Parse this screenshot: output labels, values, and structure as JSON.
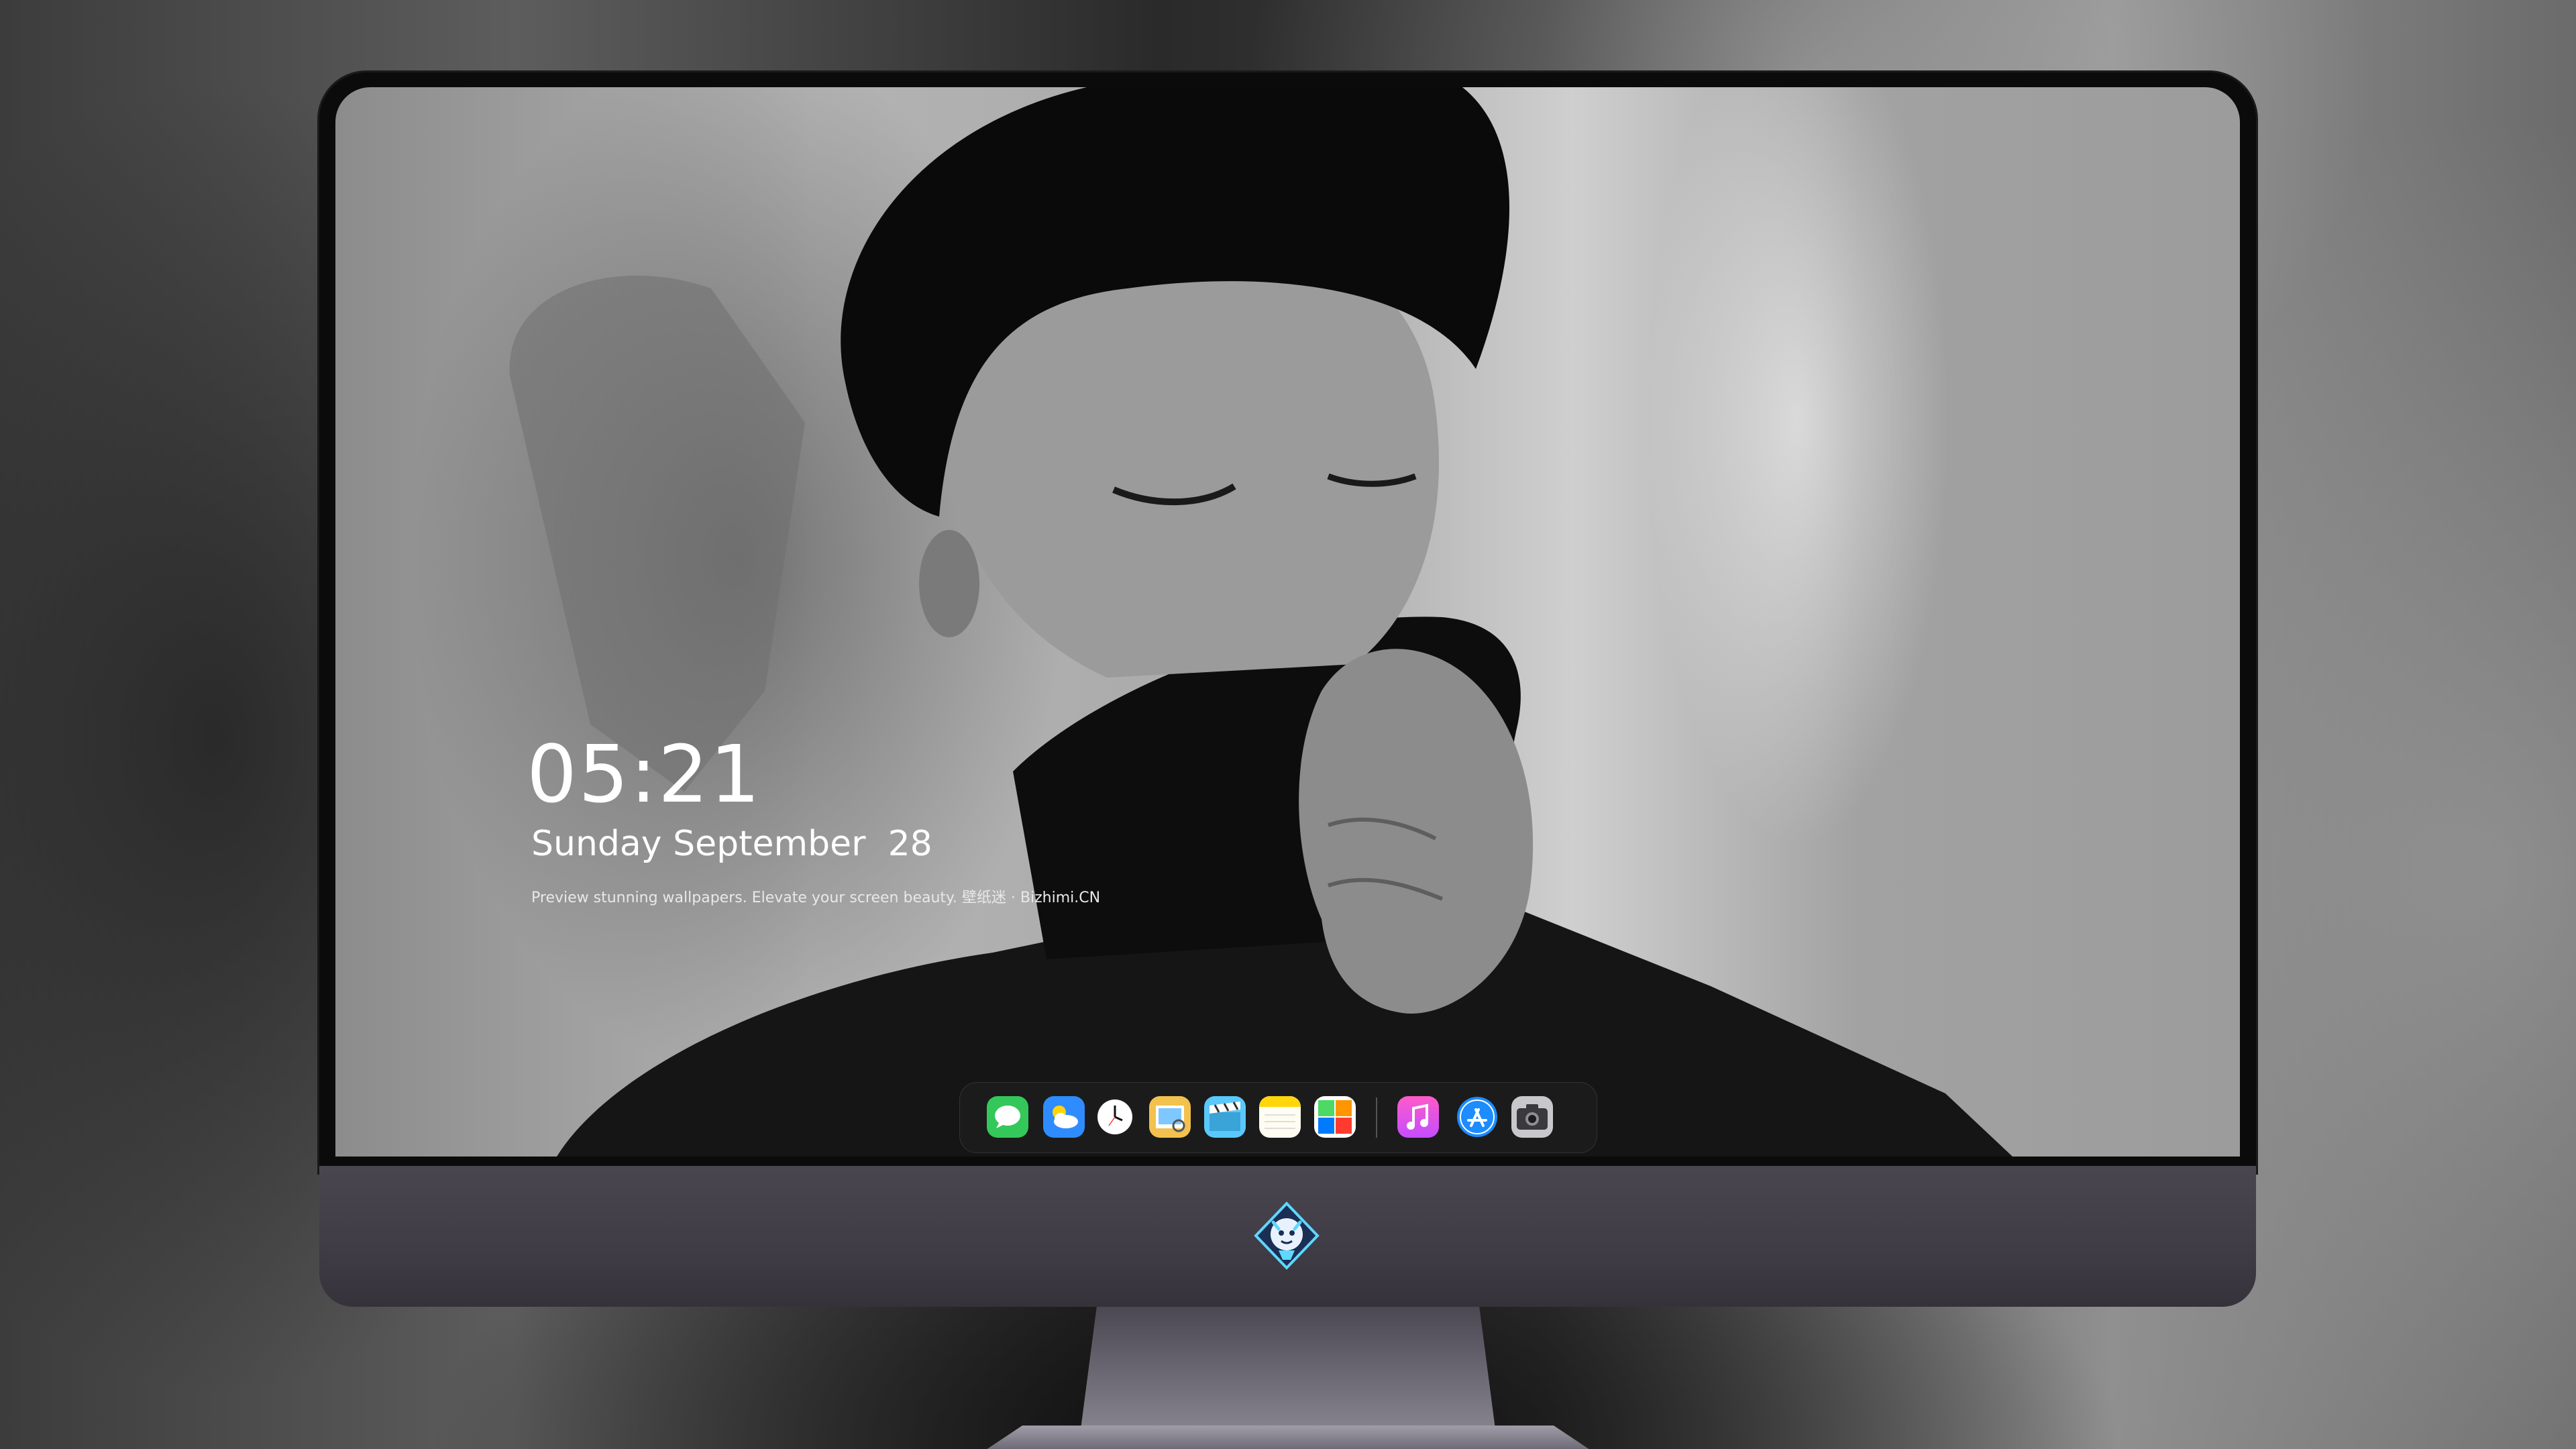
{
  "lockscreen": {
    "time": "05:21",
    "date": "Sunday September  28",
    "tagline": "Preview stunning wallpapers. Elevate your screen beauty. 壁纸迷 · Bizhimi.CN"
  },
  "dock": {
    "apps": [
      {
        "name": "messages-icon",
        "color": "#34c759"
      },
      {
        "name": "weather-icon",
        "color": "#2f8cff"
      },
      {
        "name": "clock-icon",
        "color": "#ffffff"
      },
      {
        "name": "preview-icon",
        "color": "#f2c14e"
      },
      {
        "name": "clips-icon",
        "color": "#5ac8fa"
      },
      {
        "name": "notes-icon",
        "color": "#ffd60a"
      },
      {
        "name": "photo-booth-icon",
        "color": "#4cd964"
      },
      {
        "name": "music-icon",
        "color": "#ff2d92"
      },
      {
        "name": "app-store-icon",
        "color": "#1c8cff"
      },
      {
        "name": "camera-icon",
        "color": "#8e8e93"
      }
    ]
  },
  "monitor": {
    "logo": "dragon-mascot-logo"
  }
}
